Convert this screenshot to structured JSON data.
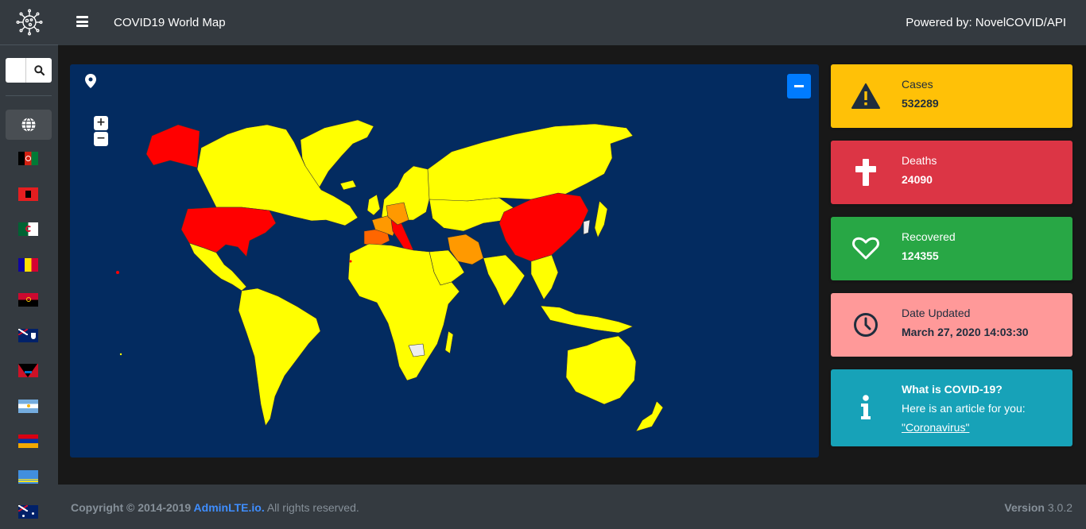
{
  "navbar": {
    "title": "COVID19 World Map",
    "powered_by": "Powered by: NovelCOVID/API"
  },
  "sidebar": {
    "logo_icon": "virus-icon",
    "search_placeholder": "",
    "globe_icon": "globe-icon",
    "flags": [
      "Afghanistan",
      "Albania",
      "Algeria",
      "Andorra",
      "Angola",
      "Anguilla",
      "Antigua and Barbuda",
      "Argentina",
      "Armenia",
      "Aruba",
      "Australia"
    ]
  },
  "map": {
    "zoom_in": "+",
    "zoom_out": "−",
    "colors": {
      "ocean": "#032b60",
      "low": "#ffff00",
      "medium": "#ff9900",
      "high": "#ff0000",
      "none": "#eeeeee"
    }
  },
  "stats": {
    "cases_label": "Cases",
    "cases_value": "532289",
    "deaths_label": "Deaths",
    "deaths_value": "24090",
    "recovered_label": "Recovered",
    "recovered_value": "124355",
    "updated_label": "Date Updated",
    "updated_value": "March 27, 2020 14:03:30",
    "info_title": "What is COVID-19?",
    "info_text": "Here is an article for you:",
    "info_link": "\"Coronavirus\""
  },
  "footer": {
    "copyright_prefix": "Copyright © 2014-2019 ",
    "brand": "AdminLTE.io.",
    "suffix": " All rights reserved.",
    "version_label": "Version",
    "version_value": " 3.0.2"
  },
  "colors": {
    "cases": "#ffc107",
    "deaths": "#dc3545",
    "recovered": "#28a745",
    "updated": "#ff9999",
    "info": "#17a2b8"
  }
}
